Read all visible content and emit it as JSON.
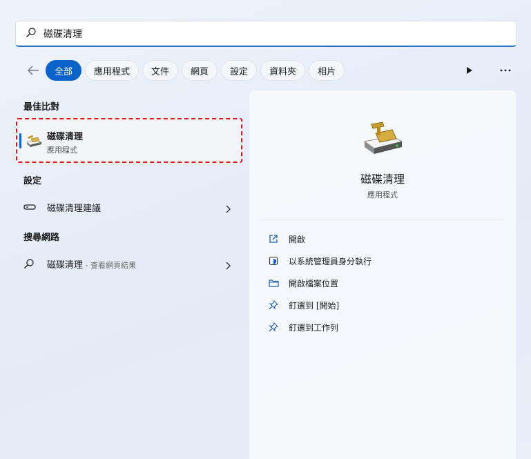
{
  "search": {
    "query": "磁碟清理"
  },
  "filters": {
    "chips": [
      "全部",
      "應用程式",
      "文件",
      "網頁",
      "設定",
      "資料夾",
      "相片"
    ],
    "active_index": 0
  },
  "sections": {
    "best_match": "最佳比對",
    "settings": "設定",
    "web_search": "搜尋網路"
  },
  "best_match_item": {
    "title": "磁碟清理",
    "subtitle": "應用程式"
  },
  "settings_item": {
    "label": "磁碟清理建議"
  },
  "web_item": {
    "label": "磁碟清理",
    "suffix": " - 查看網頁結果"
  },
  "detail": {
    "app_name": "磁碟清理",
    "app_type": "應用程式",
    "actions": [
      {
        "label": "開啟",
        "icon": "open-external-icon"
      },
      {
        "label": "以系統管理員身分執行",
        "icon": "shield-icon"
      },
      {
        "label": "開啟檔案位置",
        "icon": "folder-icon"
      },
      {
        "label": "釘選到 [開始]",
        "icon": "pin-icon"
      },
      {
        "label": "釘選到工作列",
        "icon": "pin-icon"
      }
    ]
  },
  "colors": {
    "accent": "#0a63c9",
    "highlight_border": "#e0141a"
  }
}
